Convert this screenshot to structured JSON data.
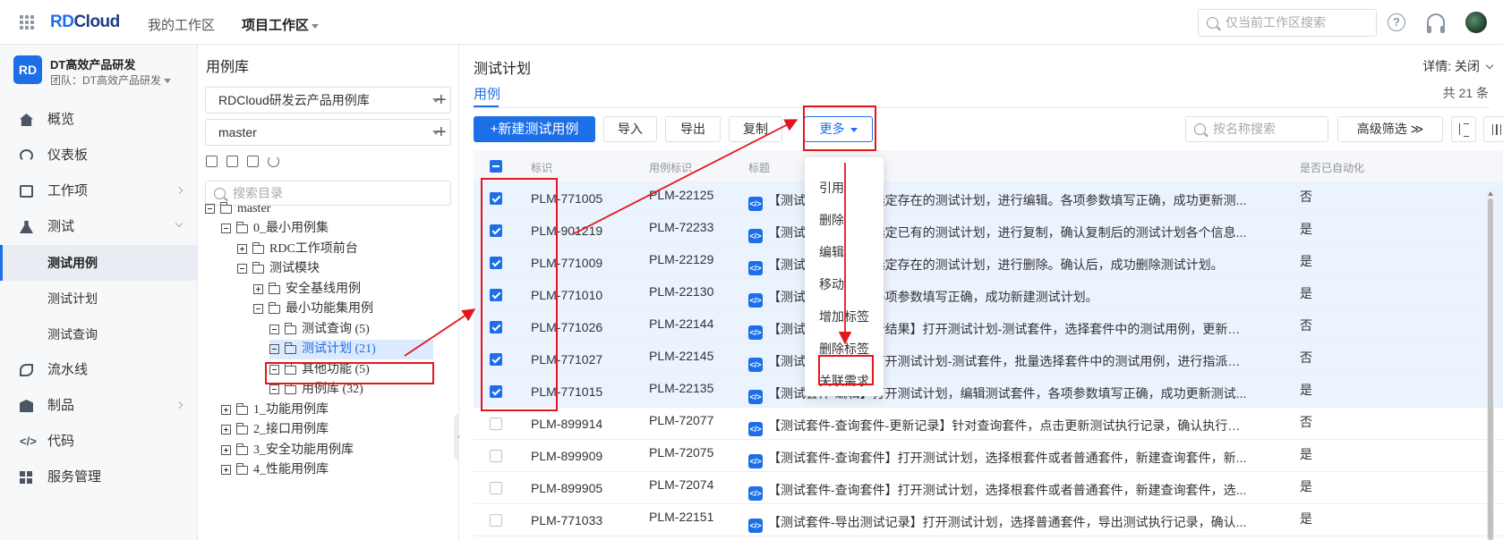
{
  "topbar": {
    "logo_rd": "RD",
    "logo_cloud": "Cloud",
    "nav_my_workspace": "我的工作区",
    "nav_project_workspace": "项目工作区",
    "search_placeholder": "仅当前工作区搜索"
  },
  "sidebar": {
    "team_badge": "RD",
    "team_name": "DT高效产品研发",
    "team_sub": "团队：DT高效产品研发",
    "items": [
      {
        "label": "概览"
      },
      {
        "label": "仪表板"
      },
      {
        "label": "工作项"
      },
      {
        "label": "测试"
      },
      {
        "label": "测试用例"
      },
      {
        "label": "测试计划"
      },
      {
        "label": "测试查询"
      },
      {
        "label": "流水线"
      },
      {
        "label": "制品"
      },
      {
        "label": "代码"
      },
      {
        "label": "服务管理"
      }
    ]
  },
  "tree_panel": {
    "title": "用例库",
    "library_select": "RDCloud研发云产品用例库",
    "branch_select": "master",
    "search_placeholder": "搜索目录",
    "nodes": [
      {
        "label": "master"
      },
      {
        "label": "0_最小用例集"
      },
      {
        "label": "RDC工作项前台"
      },
      {
        "label": "测试模块"
      },
      {
        "label": "安全基线用例"
      },
      {
        "label": "最小功能集用例"
      },
      {
        "label": "测试查询 (5)"
      },
      {
        "label": "测试计划 (21)"
      },
      {
        "label": "其他功能 (5)"
      },
      {
        "label": "用例库 (32)"
      },
      {
        "label": "1_功能用例库"
      },
      {
        "label": "2_接口用例库"
      },
      {
        "label": "3_安全功能用例库"
      },
      {
        "label": "4_性能用例库"
      }
    ]
  },
  "main": {
    "title": "测试计划",
    "detail_toggle": "详情: 关闭",
    "tab_case": "用例",
    "total": "共 21 条",
    "toolbar": {
      "new_case": "+新建测试用例",
      "import": "导入",
      "export": "导出",
      "copy": "复制",
      "more": "更多",
      "name_search_placeholder": "按名称搜索",
      "advanced_filter": "高级筛选 ≫"
    },
    "columns": {
      "id": "标识",
      "ref": "用例标识",
      "title": "标题",
      "automated": "是否已自动化"
    },
    "rows": [
      {
        "id": "PLM-771005",
        "ref": "PLM-22125",
        "title": "【测试计划-编辑】选定存在的测试计划，进行编辑。各项参数填写正确，成功更新测...",
        "auto": "否"
      },
      {
        "id": "PLM-901219",
        "ref": "PLM-72233",
        "title": "【测试计划-复制】选定已有的测试计划，进行复制，确认复制后的测试计划各个信息...",
        "auto": "是"
      },
      {
        "id": "PLM-771009",
        "ref": "PLM-22129",
        "title": "【测试计划-删除】选定存在的测试计划，进行删除。确认后，成功删除测试计划。",
        "auto": "是"
      },
      {
        "id": "PLM-771010",
        "ref": "PLM-22130",
        "title": "【测试计划-新建】各项参数填写正确，成功新建测试计划。",
        "auto": "是"
      },
      {
        "id": "PLM-771026",
        "ref": "PLM-22144",
        "title": "【测试套件-更新执行结果】打开测试计划-测试套件，选择套件中的测试用例，更新执...",
        "auto": "否"
      },
      {
        "id": "PLM-771027",
        "ref": "PLM-22145",
        "title": "【测试套件-指派】打开测试计划-测试套件，批量选择套件中的测试用例，进行指派。...",
        "auto": "否"
      },
      {
        "id": "PLM-771015",
        "ref": "PLM-22135",
        "title": "【测试套件-编辑】打开测试计划，编辑测试套件，各项参数填写正确，成功更新测试...",
        "auto": "是"
      },
      {
        "id": "PLM-899914",
        "ref": "PLM-72077",
        "title": "【测试套件-查询套件-更新记录】针对查询套件，点击更新测试执行记录，确认执行记...",
        "auto": "否"
      },
      {
        "id": "PLM-899909",
        "ref": "PLM-72075",
        "title": "【测试套件-查询套件】打开测试计划，选择根套件或者普通套件，新建查询套件，新...",
        "auto": "是"
      },
      {
        "id": "PLM-899905",
        "ref": "PLM-72074",
        "title": "【测试套件-查询套件】打开测试计划，选择根套件或者普通套件，新建查询套件，选...",
        "auto": "是"
      },
      {
        "id": "PLM-771033",
        "ref": "PLM-22151",
        "title": "【测试套件-导出测试记录】打开测试计划，选择普通套件，导出测试执行记录，确认...",
        "auto": "是"
      }
    ],
    "more_menu": [
      {
        "label": "引用"
      },
      {
        "label": "删除"
      },
      {
        "label": "编辑"
      },
      {
        "label": "移动"
      },
      {
        "label": "增加标签"
      },
      {
        "label": "删除标签"
      },
      {
        "label": "关联需求"
      }
    ]
  },
  "colors": {
    "accent": "#1d6fe8",
    "annotation": "#e3161c",
    "row_selected": "#ebf3fe"
  }
}
